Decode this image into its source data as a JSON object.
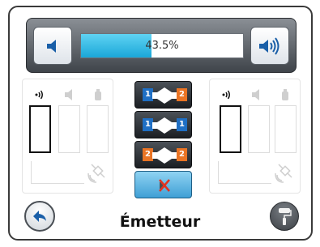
{
  "volume": {
    "level_text": "43.5%",
    "level_fraction": 0.435,
    "down_icon": "speaker-low-icon",
    "up_icon": "speaker-high-icon"
  },
  "left_panel": {
    "icons": [
      "signal-icon",
      "speaker-icon",
      "bottle-icon",
      "satellite-icon"
    ],
    "active_channel": 0
  },
  "right_panel": {
    "icons": [
      "signal-icon",
      "speaker-icon",
      "bottle-icon",
      "satellite-icon"
    ],
    "active_channel": 0
  },
  "modes": [
    {
      "left_badge": "1",
      "left_color": "#1f6fc4",
      "right_badge": "2",
      "right_color": "#ea7424"
    },
    {
      "left_badge": "1",
      "left_color": "#1f6fc4",
      "right_badge": "1",
      "right_color": "#1f6fc4"
    },
    {
      "left_badge": "2",
      "left_color": "#ea7424",
      "right_badge": "2",
      "right_color": "#ea7424"
    }
  ],
  "cancel_icon": "close-x-icon",
  "back_icon": "back-arrow-icon",
  "tool_icon": "paint-roller-icon",
  "title": "Émetteur",
  "colors": {
    "accent": "#1aa7d8",
    "badge_blue": "#1f6fc4",
    "badge_orange": "#ea7424"
  }
}
